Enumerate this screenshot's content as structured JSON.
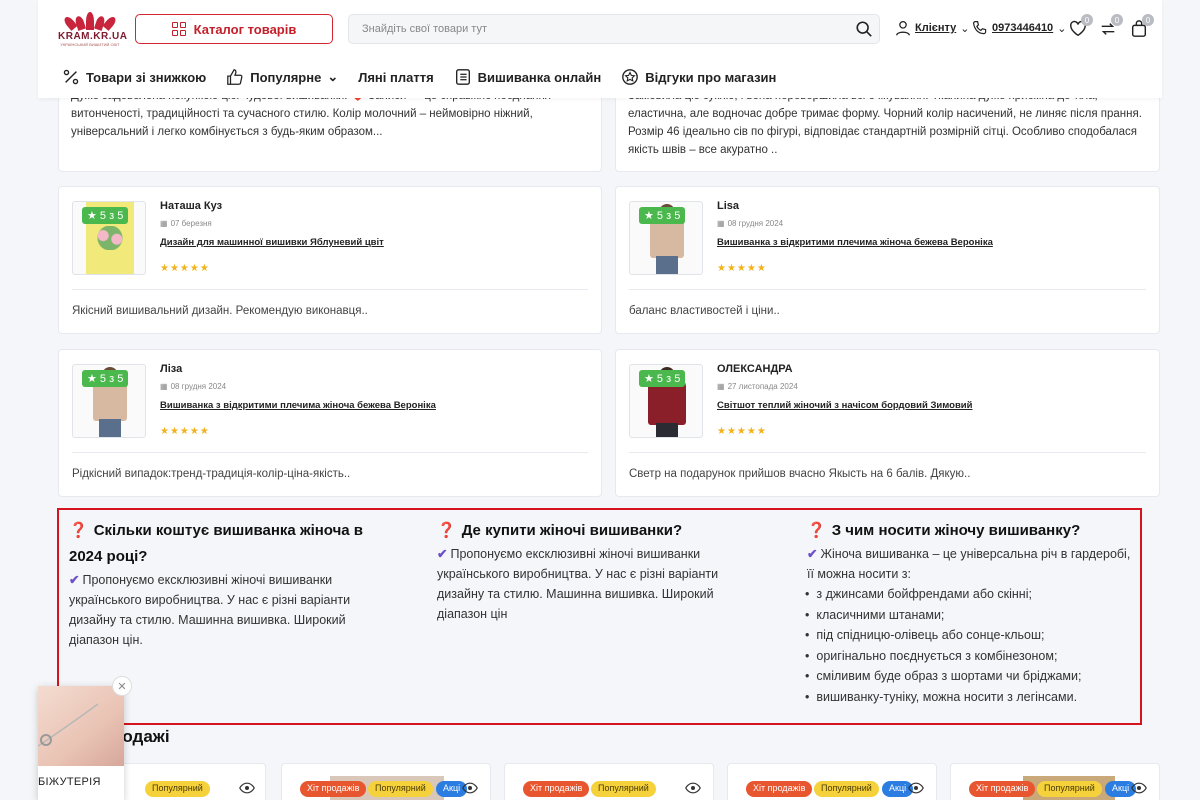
{
  "header": {
    "logo_name": "KRAM.KR.UA",
    "logo_tag": "УКРАЇНСЬКИЙ ВИШИТИЙ СВІТ",
    "catalog_label": "Каталог товарів",
    "search_placeholder": "Знайдіть свої товари тут",
    "client_label": "Клієнту",
    "phone": "0973446410",
    "wishlist_count": "0",
    "compare_count": "0",
    "cart_count": "0"
  },
  "nav": [
    {
      "label": "Товари зі знижкою",
      "icon": "percent-icon"
    },
    {
      "label": "Популярне",
      "icon": "thumbs-up-icon"
    },
    {
      "label": "Ляні плаття",
      "icon": ""
    },
    {
      "label": "Вишиванка онлайн",
      "icon": "list-icon"
    },
    {
      "label": "Відгуки про магазин",
      "icon": "star-badge-icon"
    }
  ],
  "top_reviews": [
    {
      "text": "Дуже задоволена покупкою цієї чудової вишиванки. ❤️ Записи — це справжнє поєднання витонченості, традиційності та сучасного стилю. Колір молочний – неймовірно ніжний, універсальний і легко комбінується з будь-яким образом..."
    },
    {
      "text": "Замовила цю сукню, і вона перевершила всі очікування. Тканина дуже приємна до тіла, еластична, але водночас добре тримає форму. Чорний колір насичений, не линяє після прання. Розмір 46 ідеально сів по фігурі, відповідає стандартній розмірній сітці. Особливо сподобалася якість швів – все акуратно .."
    }
  ],
  "reviews": [
    {
      "rating": "5 з 5",
      "name": "Наташа Куз",
      "date": "07 березня",
      "product": "Дизайн для машинної вишивки Яблуневий цвіт",
      "stars": "★★★★★",
      "text": "Якісний вишивальний дизайн. Рекомендую виконавця.."
    },
    {
      "rating": "5 з 5",
      "name": "Lisa",
      "date": "08 грудня 2024",
      "product": "Вишиванка з відкритими плечима жіноча бежева Вероніка",
      "stars": "★★★★★",
      "text": "баланс властивостей і ціни.."
    },
    {
      "rating": "5 з 5",
      "name": "Ліза",
      "date": "08 грудня 2024",
      "product": "Вишиванка з відкритими плечима жіноча бежева Вероніка",
      "stars": "★★★★★",
      "text": "Рідкісний випадок:тренд-традиція-колір-ціна-якість.."
    },
    {
      "rating": "5 з 5",
      "name": "ОЛЕКСАНДРА",
      "date": "27 листопада 2024",
      "product": "Світшот теплий жіночий з начісом бордовий Зимовий",
      "stars": "★★★★★",
      "text": "Светр на подарунок прийшов вчасно Якысть на 6 балів. Дякую.."
    }
  ],
  "faq": {
    "q1_title": "Скільки коштує вишиванка жіноча в 2024 році?",
    "q1_body": "Пропонуємо ексклюзивні жіночі вишиванки українського виробництва. У нас є різні варіанти дизайну та стилю. Машинна вишивка. Широкий діапазон цін.",
    "q2_title": "Де купити жіночі вишиванки?",
    "q2_body": "Пропонуємо ексклюзивні жіночі вишиванки українського виробництва. У нас є різні варіанти дизайну та стилю. Машинна вишивка. Широкий діапазон цін",
    "q3_title": "З чим носити жіночу вишиванку?",
    "q3_intro": "Жіноча вишиванка – це універсальна річ в гардеробі, її можна носити з:",
    "q3_items": [
      "з джинсами бойфрендами або скінні;",
      "класичними штанами;",
      "під спідницю-олівець або сонце-кльош;",
      "оригінально поєднується з комбінезоном;",
      "сміливим буде образ з шортами чи бріджами;",
      "вишиванку-туніку, можна носити з легінсами."
    ]
  },
  "section_title": "родажі",
  "popup_label": "БІЖУТЕРІЯ",
  "chips": {
    "hit": "Хіт продажів",
    "pop": "Популярний",
    "akc": "Акці"
  },
  "colors": {
    "accent": "#d42630",
    "rating_green": "#4ab84c",
    "star": "#f2b21c",
    "check": "#6d4fc7"
  }
}
